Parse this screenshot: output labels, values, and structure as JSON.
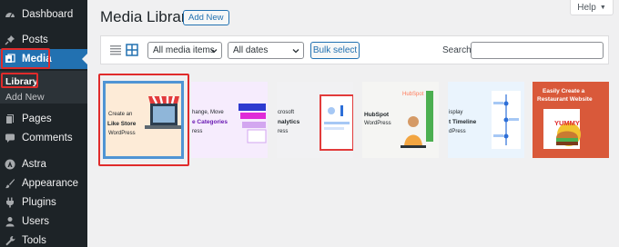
{
  "sidebar": {
    "items": [
      {
        "label": "Dashboard",
        "icon": "dashboard-icon"
      },
      {
        "label": "Posts",
        "icon": "pushpin-icon"
      },
      {
        "label": "Media",
        "icon": "media-icon"
      },
      {
        "label": "Pages",
        "icon": "pages-icon"
      },
      {
        "label": "Comments",
        "icon": "comment-icon"
      },
      {
        "label": "Astra",
        "icon": "astra-icon"
      },
      {
        "label": "Appearance",
        "icon": "paintbrush-icon"
      },
      {
        "label": "Plugins",
        "icon": "plugin-icon"
      },
      {
        "label": "Users",
        "icon": "users-icon"
      },
      {
        "label": "Tools",
        "icon": "wrench-icon"
      }
    ],
    "submenu": [
      {
        "label": "Library"
      },
      {
        "label": "Add New"
      }
    ]
  },
  "help": {
    "label": "Help"
  },
  "header": {
    "title": "Media Library",
    "add_new_label": "Add New"
  },
  "toolbar": {
    "type_filter": "All media items",
    "date_filter": "All dates",
    "bulk_select_label": "Bulk select",
    "search_label": "Search",
    "search_value": ""
  },
  "attachments": [
    {
      "lines": [
        "Create an",
        "Like Store",
        "WordPress"
      ]
    },
    {
      "lines": [
        "hange, Move",
        "e Categories",
        "ress"
      ]
    },
    {
      "lines": [
        "crosoft",
        "nalytics",
        "ress"
      ]
    },
    {
      "lines": [
        "HubSpot",
        "HubSpot",
        "WordPress"
      ]
    },
    {
      "lines": [
        "isplay",
        "t Timeline",
        "dPress"
      ]
    },
    {
      "lines": [
        "Easily Create a",
        "Restaurant Website",
        "YUMMY"
      ]
    }
  ],
  "colors": {
    "sidebar_bg": "#1d2327",
    "accent": "#2271b1",
    "highlight": "#e02b2b",
    "restaurant_bg": "#d9593a"
  }
}
